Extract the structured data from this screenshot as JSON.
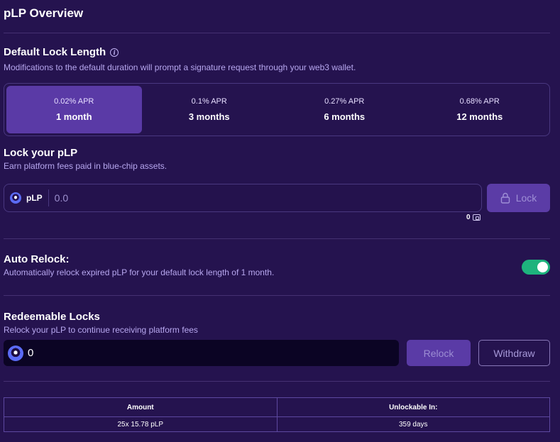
{
  "title": "pLP Overview",
  "lock_length": {
    "title": "Default Lock Length",
    "subtitle": "Modifications to the default duration will prompt a signature request through your web3 wallet.",
    "options": [
      {
        "apr": "0.02% APR",
        "label": "1 month",
        "selected": true
      },
      {
        "apr": "0.1% APR",
        "label": "3 months",
        "selected": false
      },
      {
        "apr": "0.27% APR",
        "label": "6 months",
        "selected": false
      },
      {
        "apr": "0.68% APR",
        "label": "12 months",
        "selected": false
      }
    ]
  },
  "lock": {
    "title": "Lock your pLP",
    "subtitle": "Earn platform fees paid in blue-chip assets.",
    "token": "pLP",
    "placeholder": "0.0",
    "button": "Lock",
    "balance": "0"
  },
  "auto_relock": {
    "title": "Auto Relock:",
    "subtitle": "Automatically relock expired pLP for your default lock length of 1 month.",
    "enabled": true
  },
  "redeemable": {
    "title": "Redeemable Locks",
    "subtitle": "Relock your pLP to continue receiving platform fees",
    "value": "0",
    "relock_button": "Relock",
    "withdraw_button": "Withdraw"
  },
  "locks_table": {
    "headers": [
      "Amount",
      "Unlockable In:"
    ],
    "rows": [
      [
        "25x 15.78 pLP",
        "359 days"
      ]
    ]
  },
  "colors": {
    "background": "#25134f",
    "accent": "#5a3aa6",
    "toggle_on": "#1eb37d"
  }
}
